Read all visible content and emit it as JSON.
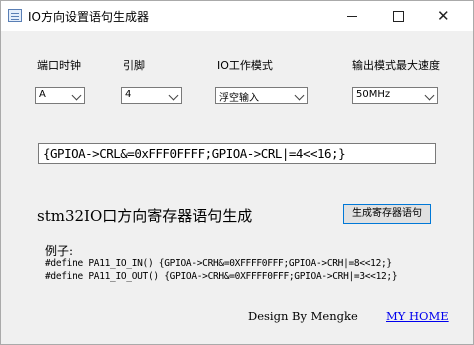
{
  "window": {
    "title": "IO方向设置语句生成器"
  },
  "labels": {
    "port_clock": "端口时钟",
    "pin": "引脚",
    "io_mode": "IO工作模式",
    "output_speed": "输出模式最大速度"
  },
  "combos": {
    "port_value": "A",
    "pin_value": "4",
    "mode_value": "浮空输入",
    "speed_value": "50MHz"
  },
  "code_output": "{GPIOA->CRL&=0xFFF0FFFF;GPIOA->CRL|=4<<16;}",
  "heading": "stm32IO口方向寄存器语句生成",
  "generate_button": "生成寄存器语句",
  "example": {
    "label": "例子:",
    "line1": "#define PA11_IO_IN()  {GPIOA->CRH&=0XFFFF0FFF;GPIOA->CRH|=8<<12;}",
    "line2": "#define PA11_IO_OUT() {GPIOA->CRH&=0XFFFF0FFF;GPIOA->CRH|=3<<12;}"
  },
  "footer": {
    "author": "Design By Mengke",
    "home_link": "MY HOME"
  }
}
